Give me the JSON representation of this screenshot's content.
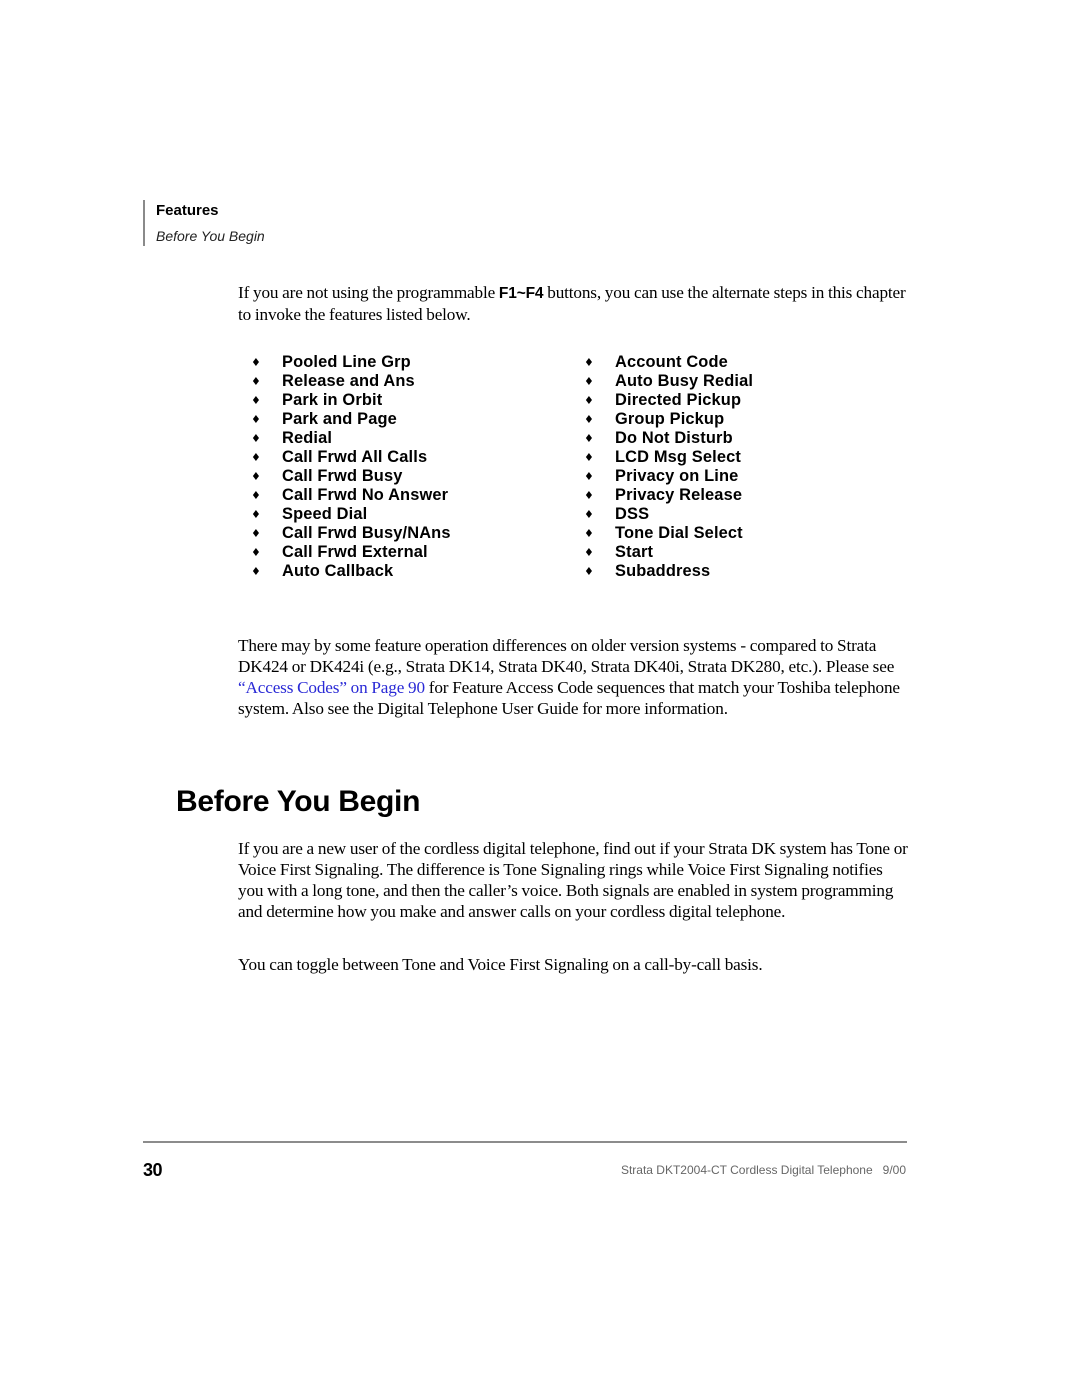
{
  "header": {
    "section": "Features",
    "subsection": "Before You Begin"
  },
  "intro": {
    "before": "If you are not using the programmable ",
    "keys": "F1~F4",
    "after": " buttons, you can use the alternate steps in this chapter to invoke the features listed below."
  },
  "features": {
    "bullet_icon": "diamond-bullet",
    "left": [
      "Pooled Line Grp",
      "Release and Ans",
      "Park in Orbit",
      "Park and Page",
      "Redial",
      "Call Frwd All Calls",
      "Call Frwd Busy",
      "Call Frwd No Answer",
      "Speed Dial",
      "Call Frwd Busy/NAns",
      "Call Frwd External",
      "Auto Callback"
    ],
    "right": [
      "Account Code",
      "Auto Busy Redial",
      "Directed Pickup",
      "Group Pickup",
      "Do Not Disturb",
      "LCD Msg Select",
      "Privacy on Line",
      "Privacy Release",
      "DSS",
      "Tone Dial Select",
      "Start",
      "Subaddress"
    ]
  },
  "differences": {
    "before": "There may by some feature operation differences on older version systems - compared to Strata DK424 or DK424i (e.g., Strata DK14, Strata DK40, Strata DK40i, Strata DK280, etc.). Please see ",
    "link": "“Access Codes” on Page 90",
    "after": " for Feature Access Code sequences that match your Toshiba telephone system. Also see the Digital Telephone User Guide for more information.",
    "link_color": "#2a2ad6"
  },
  "section": {
    "heading": "Before You Begin",
    "paragraph1": "If you are a new user of the cordless digital telephone, find out if your Strata DK system has Tone or Voice First Signaling. The difference is Tone Signaling rings while Voice First Signaling notifies you with a long tone, and then the caller’s voice. Both signals are enabled in system programming and determine how you make and answer calls on your cordless digital telephone.",
    "paragraph2": "You can toggle between Tone and Voice First Signaling on a call-by-call basis."
  },
  "footer": {
    "page_number": "30",
    "title": "Strata DKT2004-CT Cordless Digital Telephone   9/00"
  }
}
